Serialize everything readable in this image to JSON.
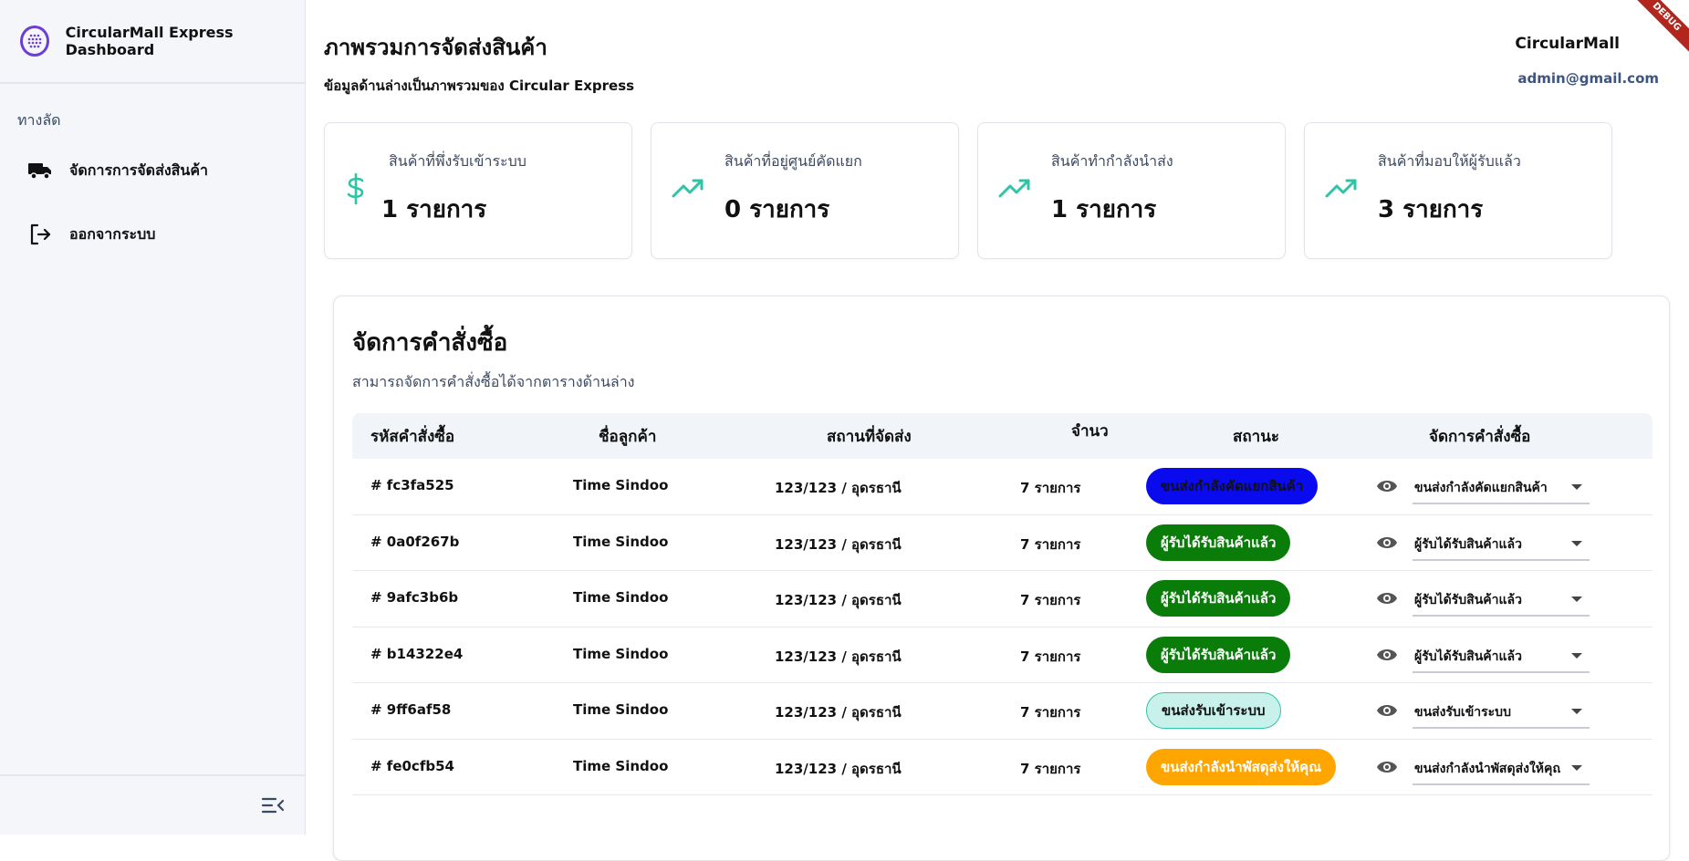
{
  "sidebar": {
    "brand_title": "CircularMall Express Dashboard",
    "section_label": "ทางลัด",
    "items": [
      {
        "label": "จัดการการจัดส่งสินค้า",
        "icon": "truck-icon"
      },
      {
        "label": "ออกจากระบบ",
        "icon": "logout-icon"
      }
    ],
    "collapse_icon": "menu-collapse-icon"
  },
  "header": {
    "title": "ภาพรวมการจัดส่งสินค้า",
    "subtitle": "ข้อมูลด้านล่างเป็นภาพรวมของ Circular Express",
    "user_name": "CircularMall",
    "user_email": "admin@gmail.com"
  },
  "cards": [
    {
      "label": "สินค้าที่พึ่งรับเข้าระบบ",
      "value": "1 รายการ",
      "icon": "dollar-icon"
    },
    {
      "label": "สินค้าที่อยู่ศูนย์คัดแยก",
      "value": "0 รายการ",
      "icon": "trending-up-icon"
    },
    {
      "label": "สินค้าทำกำลังนำส่ง",
      "value": "1 รายการ",
      "icon": "trending-up-icon"
    },
    {
      "label": "สินค้าที่มอบให้ผู้รับแล้ว",
      "value": "3 รายการ",
      "icon": "trending-up-icon"
    }
  ],
  "orders": {
    "title": "จัดการคำสั่งซื้อ",
    "subtitle": "สามารถจัดการคำสั่งซื้อได้จากตารางด้านล่าง",
    "columns": [
      "รหัสคำสั่งซื้อ",
      "ชื่อลูกค้า",
      "สถานที่จัดส่ง",
      "จำนวน",
      "สถานะ",
      "จัดการคำสั่งซื้อ"
    ],
    "rows": [
      {
        "id": "# fc3fa525",
        "customer": "Time Sindoo",
        "address": "123/123 / อุดรธานี",
        "qty": "7 รายการ",
        "status": "ขนส่งกำลังคัดแยกสินค้า",
        "action": "ขนส่งกำลังคัดแยกสินค้า"
      },
      {
        "id": "# 0a0f267b",
        "customer": "Time Sindoo",
        "address": "123/123 / อุดรธานี",
        "qty": "7 รายการ",
        "status": "ผู้รับได้รับสินค้าแล้ว",
        "action": "ผู้รับได้รับสินค้าแล้ว"
      },
      {
        "id": "# 9afc3b6b",
        "customer": "Time Sindoo",
        "address": "123/123 / อุดรธานี",
        "qty": "7 รายการ",
        "status": "ผู้รับได้รับสินค้าแล้ว",
        "action": "ผู้รับได้รับสินค้าแล้ว"
      },
      {
        "id": "# b14322e4",
        "customer": "Time Sindoo",
        "address": "123/123 / อุดรธานี",
        "qty": "7 รายการ",
        "status": "ผู้รับได้รับสินค้าแล้ว",
        "action": "ผู้รับได้รับสินค้าแล้ว"
      },
      {
        "id": "# 9ff6af58",
        "customer": "Time Sindoo",
        "address": "123/123 / อุดรธานี",
        "qty": "7 รายการ",
        "status": "ขนส่งรับเข้าระบบ",
        "action": "ขนส่งรับเข้าระบบ"
      },
      {
        "id": "# fe0cfb54",
        "customer": "Time Sindoo",
        "address": "123/123 / อุดรธานี",
        "qty": "7 รายการ",
        "status": "ขนส่งกำลังนำพัสดุส่งให้คุณ",
        "action": "ขนส่งกำลังนำพัสดุส่งให้คุณ"
      }
    ]
  },
  "colors": {
    "status_sorting_bg": "#0a0aef",
    "status_delivered_bg": "#0a7c0a",
    "status_received_bg": "#c9f1ec",
    "status_shipping_bg": "#ffa500",
    "accent_teal": "#2ec4a6",
    "brand_purple": "#6b3fd4"
  },
  "debug_banner": "DEBUG"
}
